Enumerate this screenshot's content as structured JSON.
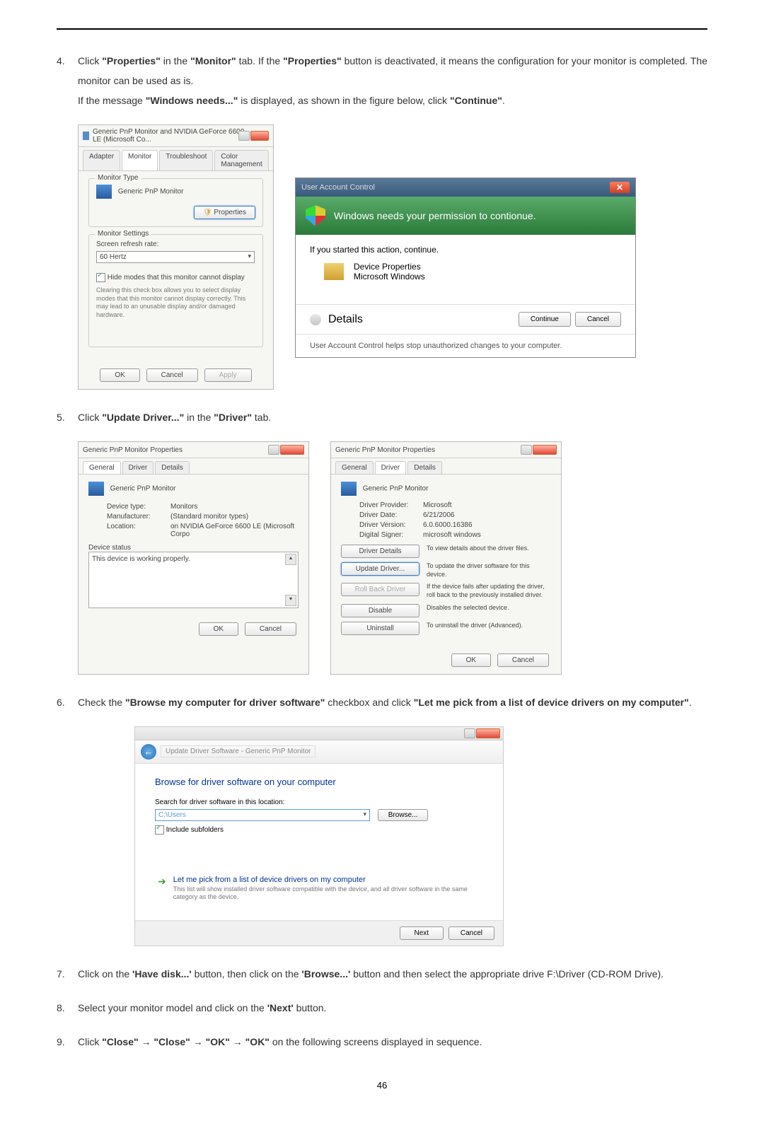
{
  "page_number": "46",
  "steps": {
    "s4": {
      "num": "4.",
      "text_before": "Click ",
      "b1": "\"Properties\"",
      "t2": " in the ",
      "b2": "\"Monitor\"",
      "t3": " tab. If the ",
      "b3": "\"Properties\"",
      "t4": " button is deactivated, it means the configuration for your monitor is completed. The monitor can be used as is.",
      "line2_t1": "If the message ",
      "line2_b1": "\"Windows needs...\"",
      "line2_t2": " is displayed, as shown in the figure below, click ",
      "line2_b2": "\"Continue\"",
      "line2_t3": "."
    },
    "s5": {
      "num": "5.",
      "t1": "Click ",
      "b1": "\"Update Driver...\"",
      "t2": " in the ",
      "b2": "\"Driver\"",
      "t3": " tab."
    },
    "s6": {
      "num": "6.",
      "t1": "Check the ",
      "b1": "\"Browse my computer for driver software\"",
      "t2": " checkbox and click ",
      "b2": "\"Let me pick from a list of device drivers on my computer\"",
      "t3": "."
    },
    "s7": {
      "num": "7.",
      "t1": "Click on the ",
      "b1": "'Have disk...'",
      "t2": " button, then click on the ",
      "b2": "'Browse...'",
      "t3": " button and then select the appropriate drive F:\\Driver (CD-ROM Drive)."
    },
    "s8": {
      "num": "8.",
      "t1": "Select your monitor model and click on the ",
      "b1": "'Next'",
      "t2": " button."
    },
    "s9": {
      "num": "9.",
      "t1": "Click ",
      "b1": "\"Close\"",
      "t2": " → ",
      "b2": "\"Close\"",
      "t3": " → ",
      "b3": "\"OK\"",
      "t4": " → ",
      "b4": "\"OK\"",
      "t5": " on the following screens displayed in sequence."
    }
  },
  "dlg_monitor": {
    "title": "Generic PnP Monitor and NVIDIA GeForce 6600 LE (Microsoft Co...",
    "tabs": {
      "adapter": "Adapter",
      "monitor": "Monitor",
      "troubleshoot": "Troubleshoot",
      "color": "Color Management"
    },
    "group1": "Monitor Type",
    "monitor_name": "Generic PnP Monitor",
    "properties_btn": "Properties",
    "group2": "Monitor Settings",
    "refresh_label": "Screen refresh rate:",
    "refresh_val": "60 Hertz",
    "hide_cb": "Hide modes that this monitor cannot display",
    "hide_note": "Clearing this check box allows you to select display modes that this monitor cannot display correctly. This may lead to an unusable display and/or damaged hardware.",
    "ok": "OK",
    "cancel": "Cancel",
    "apply": "Apply"
  },
  "uac": {
    "title": "User Account Control",
    "banner": "Windows needs your permission to contionue.",
    "started": "If you started this action, continue.",
    "prog_name": "Device Properties",
    "prog_pub": "Microsoft Windows",
    "details": "Details",
    "continue_btn": "Continue",
    "cancel_btn": "Cancel",
    "footer": "User Account Control helps stop unauthorized changes to your computer."
  },
  "dlg5a": {
    "title": "Generic PnP Monitor Properties",
    "tabs": {
      "general": "General",
      "driver": "Driver",
      "details": "Details"
    },
    "name": "Generic PnP Monitor",
    "type_l": "Device type:",
    "type_v": "Monitors",
    "mfr_l": "Manufacturer:",
    "mfr_v": "(Standard monitor types)",
    "loc_l": "Location:",
    "loc_v": "on NVIDIA GeForce 6600 LE (Microsoft Corpo",
    "status_l": "Device status",
    "status_v": "This device is working properly.",
    "ok": "OK",
    "cancel": "Cancel"
  },
  "dlg5b": {
    "title": "Generic PnP Monitor Properties",
    "tabs": {
      "general": "General",
      "driver": "Driver",
      "details": "Details"
    },
    "name": "Generic PnP Monitor",
    "prov_l": "Driver Provider:",
    "prov_v": "Microsoft",
    "date_l": "Driver Date:",
    "date_v": "6/21/2006",
    "ver_l": "Driver Version:",
    "ver_v": "6.0.6000.16386",
    "sig_l": "Digital Signer:",
    "sig_v": "microsoft windows",
    "btn1": "Driver Details",
    "d1": "To view details about the driver files.",
    "btn2": "Update Driver...",
    "d2": "To update the driver software for this device.",
    "btn3": "Roll Back Driver",
    "d3": "If the device fails after updating the driver, roll back to the previously installed driver.",
    "btn4": "Disable",
    "d4": "Disables the selected device.",
    "btn5": "Uninstall",
    "d5": "To uninstall the driver (Advanced).",
    "ok": "OK",
    "cancel": "Cancel"
  },
  "dlg6": {
    "crumb": "Update Driver Software - Generic PnP Monitor",
    "heading": "Browse for driver software on your computer",
    "search_l": "Search for driver software in this location:",
    "path": "C:\\Users",
    "browse": "Browse...",
    "include": "Include subfolders",
    "link_title": "Let me pick from a list of device drivers on my computer",
    "link_sub": "This list will show installed driver software compatible with the device, and all driver software in the same category as the device.",
    "next": "Next",
    "cancel": "Cancel"
  }
}
